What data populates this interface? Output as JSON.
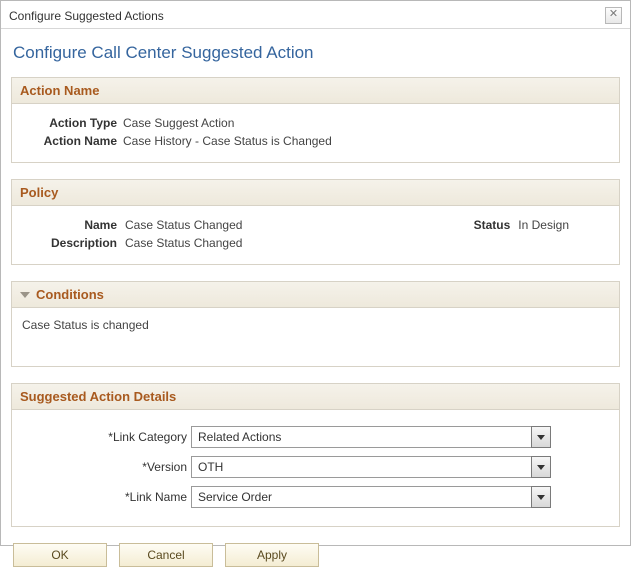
{
  "window": {
    "title": "Configure Suggested Actions"
  },
  "page": {
    "title": "Configure Call Center Suggested Action"
  },
  "actionName": {
    "heading": "Action Name",
    "typeLabel": "Action Type",
    "typeValue": "Case Suggest Action",
    "nameLabel": "Action Name",
    "nameValue": "Case History - Case Status is Changed"
  },
  "policy": {
    "heading": "Policy",
    "nameLabel": "Name",
    "nameValue": "Case Status Changed",
    "statusLabel": "Status",
    "statusValue": "In Design",
    "descLabel": "Description",
    "descValue": "Case Status Changed"
  },
  "conditions": {
    "heading": "Conditions",
    "text": "Case Status is changed"
  },
  "details": {
    "heading": "Suggested Action Details",
    "linkCategoryLabel": "*Link Category",
    "linkCategoryValue": "Related Actions",
    "versionLabel": "*Version",
    "versionValue": "OTH",
    "linkNameLabel": "*Link Name",
    "linkNameValue": "Service Order"
  },
  "buttons": {
    "ok": "OK",
    "cancel": "Cancel",
    "apply": "Apply"
  }
}
